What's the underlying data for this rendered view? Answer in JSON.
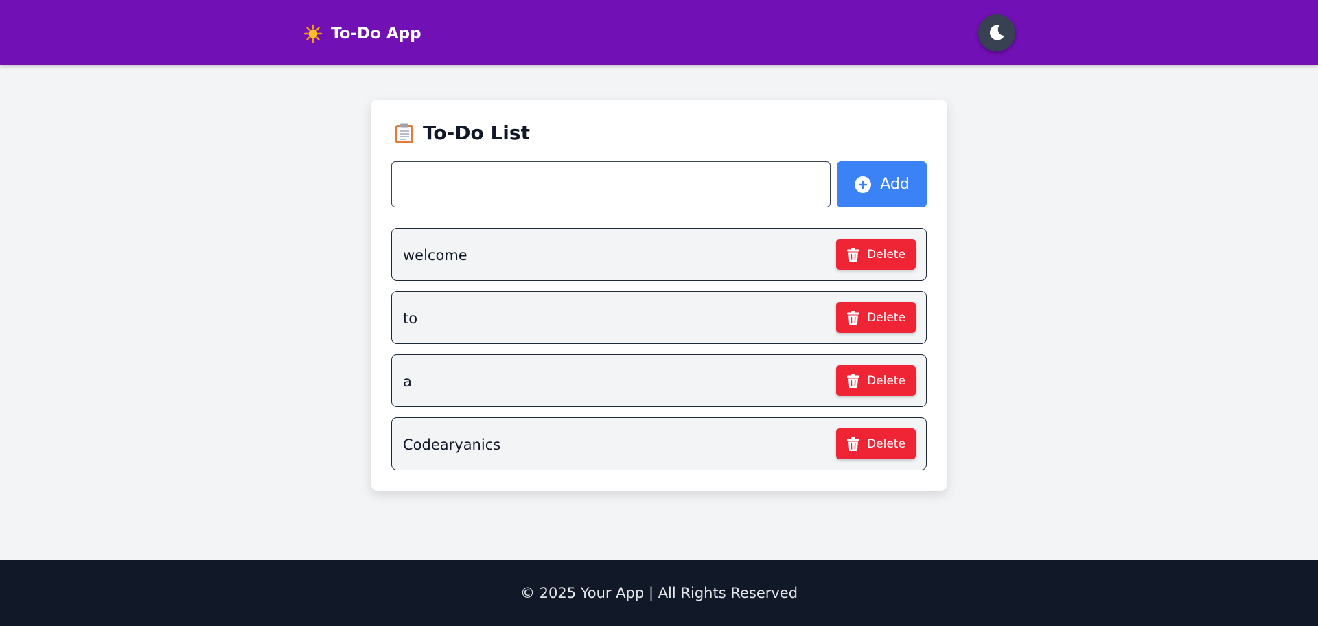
{
  "header": {
    "brand_icon": "sun-icon",
    "title": "To-Do App",
    "theme_toggle_icon": "moon-icon",
    "background_color": "#7110b5"
  },
  "card": {
    "title_icon": "clipboard-icon",
    "title": "To-Do List",
    "input": {
      "value": "",
      "placeholder": ""
    },
    "add_button": {
      "icon": "plus-circle-icon",
      "label": "Add",
      "color": "#3b82f6"
    },
    "tasks": [
      {
        "text": "welcome",
        "delete_label": "Delete"
      },
      {
        "text": "to",
        "delete_label": "Delete"
      },
      {
        "text": "a",
        "delete_label": "Delete"
      },
      {
        "text": "Codearyanics",
        "delete_label": "Delete"
      }
    ],
    "delete_color": "#ef2434"
  },
  "footer": {
    "text": "© 2025 Your App | All Rights Reserved",
    "background_color": "#111827"
  }
}
